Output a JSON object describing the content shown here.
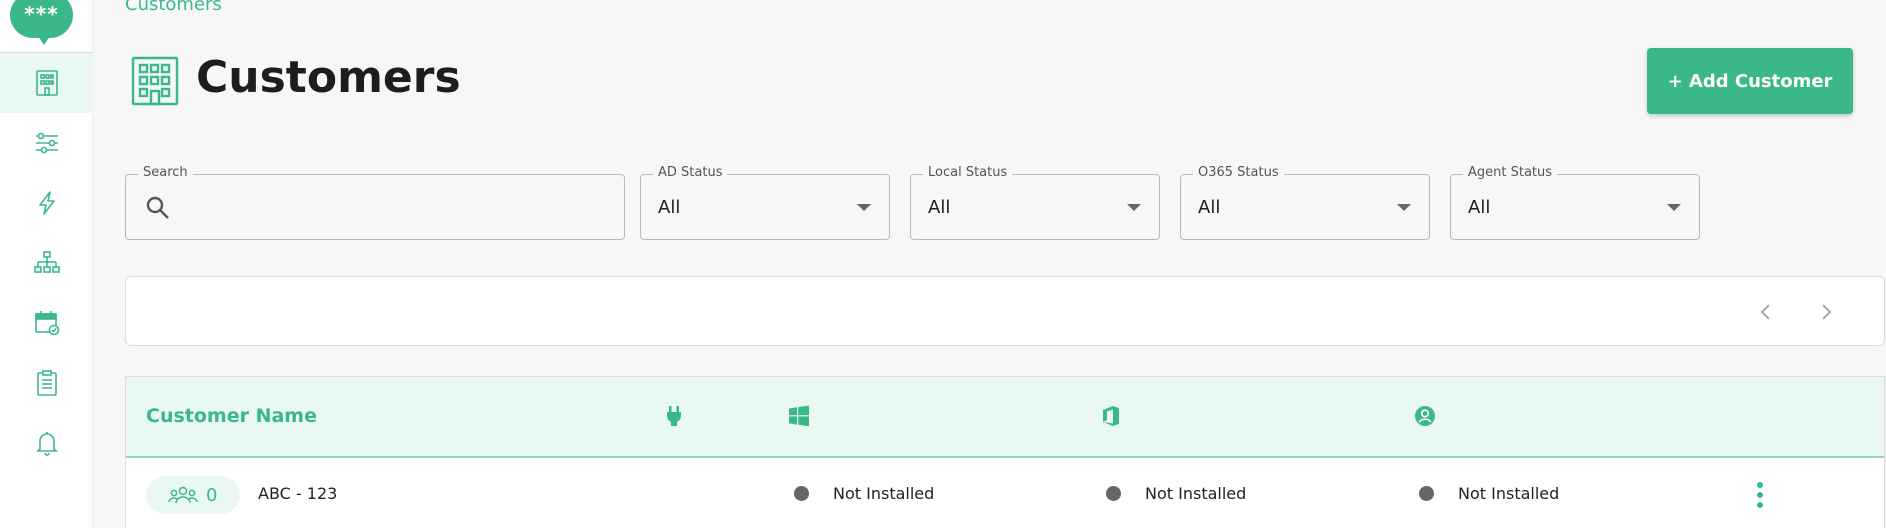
{
  "app": {
    "logo_text": "***",
    "breadcrumb": "Customers"
  },
  "sidebar": {
    "items": [
      {
        "icon": "building-icon",
        "active": true
      },
      {
        "icon": "sliders-icon",
        "active": false
      },
      {
        "icon": "lightning-icon",
        "active": false
      },
      {
        "icon": "org-chart-icon",
        "active": false
      },
      {
        "icon": "calendar-check-icon",
        "active": false
      },
      {
        "icon": "clipboard-icon",
        "active": false
      },
      {
        "icon": "bell-icon",
        "active": false
      }
    ]
  },
  "header": {
    "title": "Customers",
    "add_button_label": "+ Add Customer"
  },
  "filters": {
    "search": {
      "label": "Search",
      "value": "",
      "placeholder": ""
    },
    "ad_status": {
      "label": "AD Status",
      "value": "All"
    },
    "local_status": {
      "label": "Local Status",
      "value": "All"
    },
    "o365_status": {
      "label": "O365 Status",
      "value": "All"
    },
    "agent_status": {
      "label": "Agent Status",
      "value": "All"
    }
  },
  "table": {
    "header": {
      "customer_name": "Customer Name"
    },
    "header_icons": [
      "plug-icon",
      "windows-icon",
      "office-icon",
      "user-circle-icon"
    ],
    "rows": [
      {
        "user_count": "0",
        "name": "ABC - 123",
        "local_status": "Not Installed",
        "o365_status": "Not Installed",
        "agent_status": "Not Installed"
      }
    ]
  },
  "colors": {
    "accent": "#3ab88a",
    "accent_light": "#eaf8f2",
    "status_dot": "#666666"
  }
}
